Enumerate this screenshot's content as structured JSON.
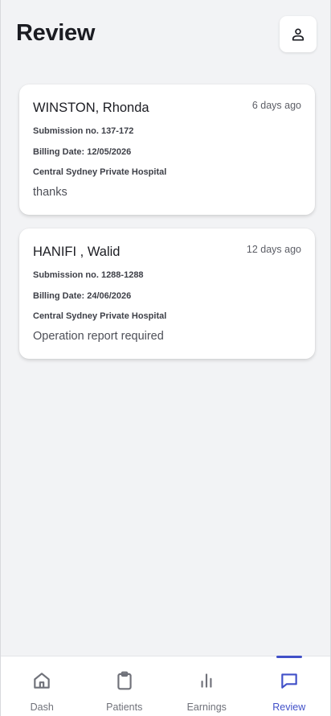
{
  "header": {
    "title": "Review",
    "profile_icon": "user-icon"
  },
  "reviews": [
    {
      "name": "WINSTON, Rhonda",
      "time_ago": "6 days ago",
      "submission": "Submission no. 137-172",
      "billing_date": "Billing Date: 12/05/2026",
      "hospital": "Central Sydney Private Hospital",
      "note": "thanks"
    },
    {
      "name": "HANIFI , Walid",
      "time_ago": "12 days ago",
      "submission": "Submission no. 1288-1288",
      "billing_date": "Billing Date: 24/06/2026",
      "hospital": "Central Sydney Private Hospital",
      "note": "Operation report required"
    }
  ],
  "nav": {
    "items": [
      {
        "label": "Dash",
        "icon": "home-icon"
      },
      {
        "label": "Patients",
        "icon": "clipboard-icon"
      },
      {
        "label": "Earnings",
        "icon": "bar-chart-icon"
      },
      {
        "label": "Review",
        "icon": "message-icon"
      }
    ],
    "active": "Review",
    "active_color": "#4150c8",
    "inactive_color": "#70727a"
  }
}
